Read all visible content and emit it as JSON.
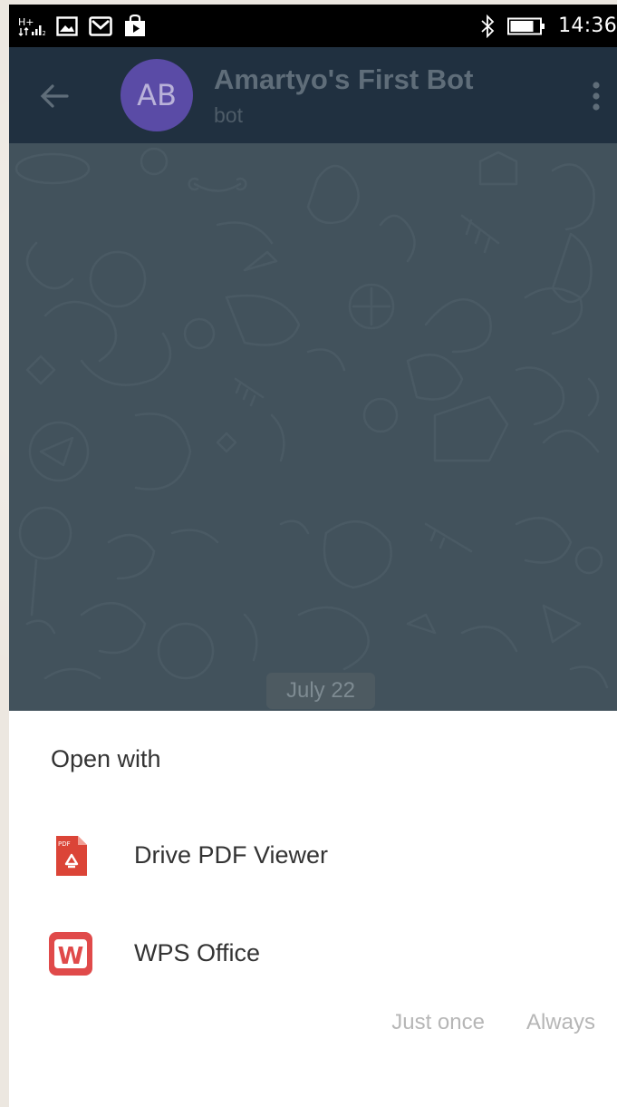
{
  "status_bar": {
    "network_label": "H+",
    "time": "14:36",
    "icons": [
      "network-icon",
      "signal-icon",
      "image-icon",
      "gmail-icon",
      "store-icon",
      "bluetooth-icon",
      "battery-icon"
    ]
  },
  "header": {
    "avatar_initials": "AB",
    "title": "Amartyo's First Bot",
    "subtitle": "bot",
    "icons": [
      "back-arrow-icon",
      "overflow-menu-icon"
    ]
  },
  "chat": {
    "date_label": "July 22"
  },
  "sheet": {
    "title": "Open with",
    "apps": [
      {
        "label": "Drive PDF Viewer",
        "icon": "drive-pdf-icon",
        "icon_text": "PDF"
      },
      {
        "label": "WPS Office",
        "icon": "wps-office-icon",
        "icon_text": "W"
      }
    ],
    "actions": {
      "just_once": "Just once",
      "always": "Always"
    }
  },
  "colors": {
    "toolbar": "#203040",
    "chat_bg": "#42525c",
    "avatar": "#5a4ba6",
    "drive_pdf": "#db4437",
    "wps": "#e04a4a"
  }
}
